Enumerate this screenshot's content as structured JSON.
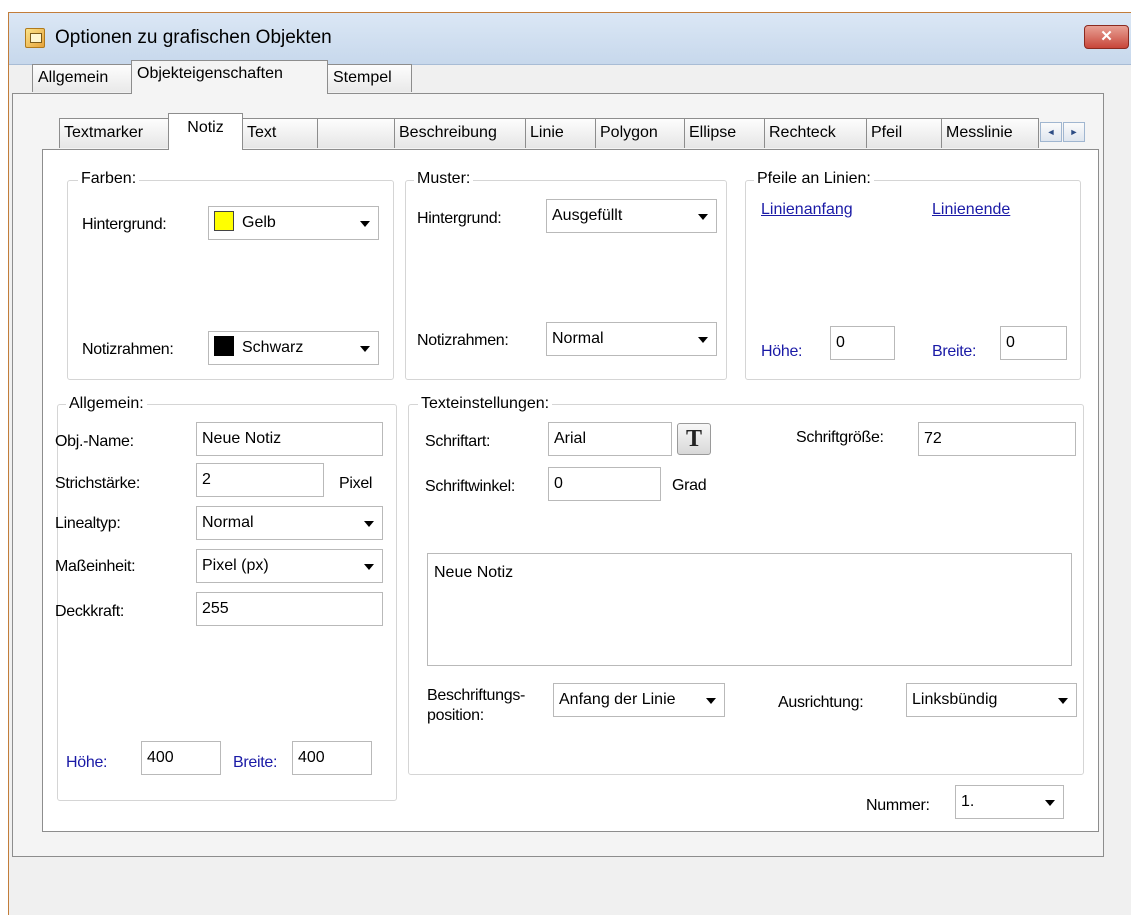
{
  "window": {
    "title": "Optionen zu grafischen Objekten",
    "close_label": "✕"
  },
  "top_tabs": [
    "Allgemein",
    "Objekteigenschaften",
    "Stempel"
  ],
  "inner_tabs": [
    "Textmarker",
    "Notiz",
    "Text",
    "",
    "Beschreibung",
    "Linie",
    "Polygon",
    "Ellipse",
    "Rechteck",
    "Pfeil",
    "Messlinie"
  ],
  "tab_scroll": {
    "left": "◄",
    "right": "►"
  },
  "farben": {
    "legend": "Farben:",
    "hintergrund_label": "Hintergrund:",
    "hintergrund_value": "Gelb",
    "hintergrund_color": "#ffff00",
    "notizrahmen_label": "Notizrahmen:",
    "notizrahmen_value": "Schwarz",
    "notizrahmen_color": "#000000"
  },
  "muster": {
    "legend": "Muster:",
    "hintergrund_label": "Hintergrund:",
    "hintergrund_value": "Ausgefüllt",
    "notizrahmen_label": "Notizrahmen:",
    "notizrahmen_value": "Normal"
  },
  "pfeile": {
    "legend": "Pfeile an Linien:",
    "linienanfang": "Linienanfang",
    "linienende": "Linienende",
    "hoehe_label": "Höhe:",
    "hoehe_value": "0",
    "breite_label": "Breite:",
    "breite_value": "0"
  },
  "allgemein": {
    "legend": "Allgemein:",
    "objname_label": "Obj.-Name:",
    "objname_value": "Neue Notiz",
    "strich_label": "Strichstärke:",
    "strich_value": "2",
    "strich_unit": "Pixel",
    "linealtyp_label": "Linealtyp:",
    "linealtyp_value": "Normal",
    "masseinheit_label": "Maßeinheit:",
    "masseinheit_value": "Pixel (px)",
    "deckkraft_label": "Deckkraft:",
    "deckkraft_value": "255",
    "hoehe_label": "Höhe:",
    "hoehe_value": "400",
    "breite_label": "Breite:",
    "breite_value": "400"
  },
  "text": {
    "legend": "Texteinstellungen:",
    "schriftart_label": "Schriftart:",
    "schriftart_value": "Arial",
    "font_button": "T",
    "schriftgroesse_label": "Schriftgröße:",
    "schriftgroesse_value": "72",
    "schriftwinkel_label": "Schriftwinkel:",
    "schriftwinkel_value": "0",
    "schriftwinkel_unit": "Grad",
    "content": "Neue Notiz",
    "beschriftung_label_1": "Beschriftungs-",
    "beschriftung_label_2": "position:",
    "beschriftung_value": "Anfang der Linie",
    "ausrichtung_label": "Ausrichtung:",
    "ausrichtung_value": "Linksbündig"
  },
  "nummer": {
    "label": "Nummer:",
    "value": "1."
  }
}
